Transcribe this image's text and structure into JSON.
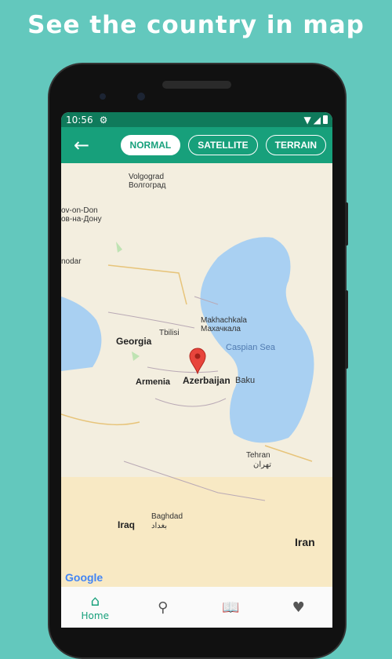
{
  "headline": "See the country in map",
  "status": {
    "time": "10:56"
  },
  "appbar": {
    "chips": [
      {
        "label": "NORMAL",
        "active": true
      },
      {
        "label": "SATELLITE"
      },
      {
        "label": "TERRAIN"
      }
    ]
  },
  "map": {
    "labels": {
      "volgograd": "Volgograd",
      "volgograd_ru": "Волгоград",
      "rostov": "ov-on-Don",
      "rostov_ru": "ов-на-Дону",
      "krasnodar": "nodar",
      "georgia": "Georgia",
      "tbilisi": "Tbilisi",
      "makhachkala": "Makhachkala",
      "makhachkala_ru": "Махачкала",
      "caspian": "Caspian Sea",
      "armenia": "Armenia",
      "azerbaijan": "Azerbaijan",
      "baku": "Baku",
      "tehran": "Tehran",
      "tehran_fa": "تهران",
      "iraq": "Iraq",
      "baghdad": "Baghdad",
      "baghdad_ar": "بغداد",
      "iran": "Iran"
    },
    "attribution": "Google"
  },
  "nav": {
    "home": "Home"
  }
}
